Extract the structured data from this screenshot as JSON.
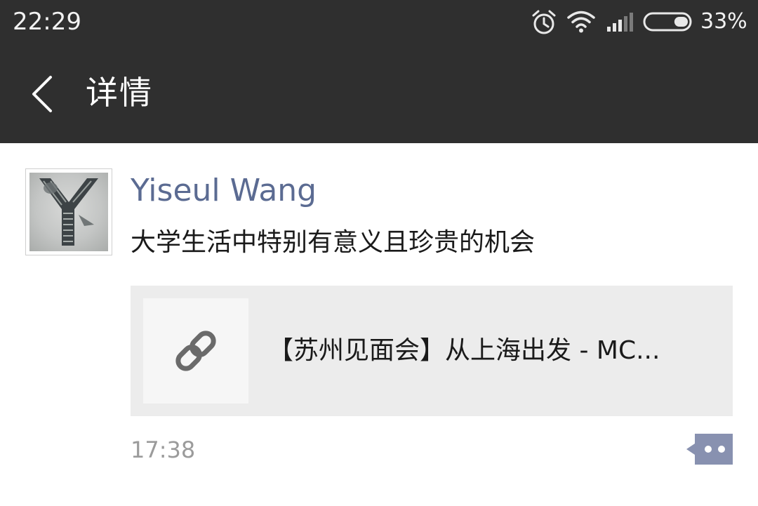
{
  "status_bar": {
    "time": "22:29",
    "battery_percent": "33%",
    "battery_level": 0.33,
    "icons": [
      "alarm-icon",
      "wifi-icon",
      "signal-icon",
      "battery-icon"
    ]
  },
  "header": {
    "back_icon": "chevron-left-icon",
    "title": "详情"
  },
  "post": {
    "author": "Yiseul Wang",
    "text": "大学生活中特别有意义且珍贵的机会",
    "link": {
      "icon": "link-icon",
      "title": "【苏州见面会】从上海出发 - MC..."
    },
    "time": "17:38",
    "comment_icon": "comment-more-icon"
  },
  "colors": {
    "header_bg": "#2f2f2f",
    "author_name": "#5b6b92",
    "link_card_bg": "#ececec",
    "time_text": "#9b9b9b",
    "comment_button": "#8891b0"
  }
}
